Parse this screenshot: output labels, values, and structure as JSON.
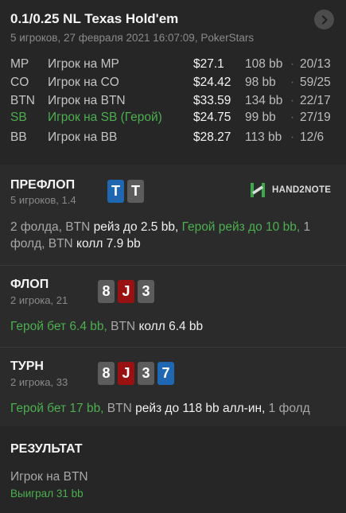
{
  "header": {
    "title": "0.1/0.25 NL Texas Hold'em",
    "subtitle": "5 игроков, 27 февраля 2021 16:07:09, PokerStars"
  },
  "players": [
    {
      "pos": "MP",
      "name": "Игрок на MP",
      "stack": "$27.1",
      "bb": "108 bb",
      "dot": "·",
      "ratio": "20/13",
      "hero": false
    },
    {
      "pos": "CO",
      "name": "Игрок на CO",
      "stack": "$24.42",
      "bb": "98 bb",
      "dot": "·",
      "ratio": "59/25",
      "hero": false
    },
    {
      "pos": "BTN",
      "name": "Игрок на BTN",
      "stack": "$33.59",
      "bb": "134 bb",
      "dot": "·",
      "ratio": "22/17",
      "hero": false
    },
    {
      "pos": "SB",
      "name": "Игрок на SB (Герой)",
      "stack": "$24.75",
      "bb": "99 bb",
      "dot": "·",
      "ratio": "27/19",
      "hero": true
    },
    {
      "pos": "BB",
      "name": "Игрок на BB",
      "stack": "$28.27",
      "bb": "113 bb",
      "dot": "·",
      "ratio": "12/6",
      "hero": false
    }
  ],
  "preflop": {
    "title": "ПРЕФЛОП",
    "sub": "5 игроков, 1.4",
    "cards": [
      "T",
      "T"
    ],
    "logo": "HAND2NOTE",
    "action": {
      "a1": "2 фолда, BTN ",
      "a2": "рейз до 2.5 bb,",
      "a3": " ",
      "a4": "Герой рейз до 10 bb,",
      "a5": " 1 фолд, BTN ",
      "a6": "колл 7.9 bb"
    }
  },
  "flop": {
    "title": "ФЛОП",
    "sub": "2 игрока, 21",
    "cards": [
      "8",
      "J",
      "3"
    ],
    "action": {
      "a1": "Герой бет 6.4 bb,",
      "a2": " BTN ",
      "a3": "колл 6.4 bb"
    }
  },
  "turn": {
    "title": "ТУРН",
    "sub": "2 игрока, 33",
    "cards": [
      "8",
      "J",
      "3",
      "7"
    ],
    "action": {
      "a1": "Герой бет 17 bb,",
      "a2": " BTN ",
      "a3": "рейз до 118 bb алл-ин,",
      "a4": " 1 фолд"
    }
  },
  "result": {
    "title": "РЕЗУЛЬТАТ",
    "winner": "Игрок на BTN",
    "won": "Выиграл 31 bb"
  },
  "colors": {
    "hero_green": "#4caf50",
    "card_blue": "#1f67b0",
    "card_gray": "#5c5c5c",
    "card_red": "#9a1111",
    "logo_green": "#3aa84b"
  },
  "icons": {
    "next": "chevron-right-icon",
    "logo": "hand2note-logo"
  }
}
